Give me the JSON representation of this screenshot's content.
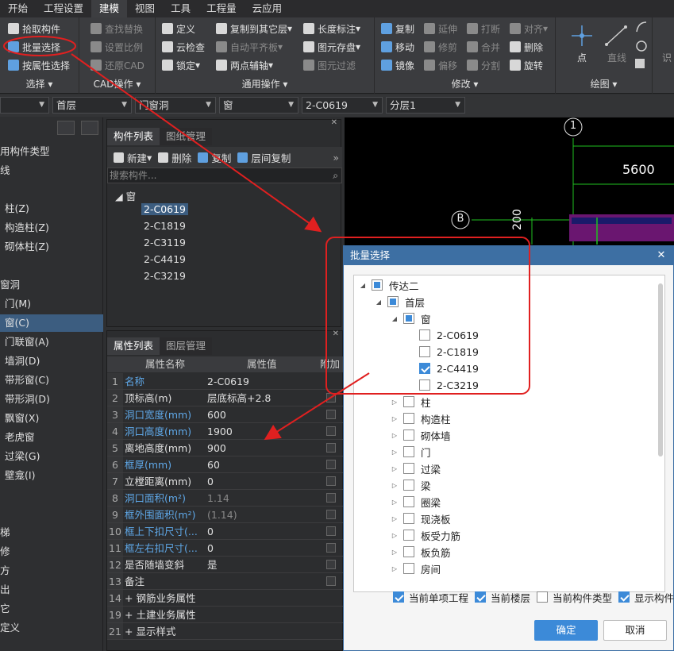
{
  "menu": {
    "tabs": [
      "开始",
      "工程设置",
      "建模",
      "视图",
      "工具",
      "工程量",
      "云应用"
    ],
    "active_index": 2
  },
  "ribbon": {
    "select_group": {
      "title": "选择",
      "items": [
        "拾取构件",
        "批量选择",
        "按属性选择"
      ]
    },
    "cad_group": {
      "title": "CAD操作",
      "items": [
        "查找替换",
        "设置比例",
        "还原CAD"
      ]
    },
    "common_group": {
      "title": "通用操作",
      "items": [
        "定义",
        "云检查",
        "锁定",
        "复制到其它层",
        "自动平齐板",
        "两点辅轴",
        "长度标注",
        "图元存盘",
        "图元过滤"
      ]
    },
    "modify_group": {
      "title": "修改",
      "items": [
        "复制",
        "移动",
        "镜像",
        "延伸",
        "修剪",
        "偏移",
        "打断",
        "合并",
        "分割",
        "对齐",
        "删除",
        "旋转"
      ]
    },
    "draw_group": {
      "title": "绘图",
      "items": [
        "点",
        "直线"
      ]
    },
    "extra": "识"
  },
  "combos": {
    "floor": "首层",
    "category": "门窗洞",
    "type": "窗",
    "component": "2-C0619",
    "layer": "分层1"
  },
  "leftnav": {
    "items": [
      "用构件类型",
      "线",
      "柱(Z)",
      "构造柱(Z)",
      "砌体柱(Z)",
      "窗洞",
      "门(M)",
      "窗(C)",
      "门联窗(A)",
      "墙洞(D)",
      "带形窗(C)",
      "带形洞(D)",
      "飘窗(X)",
      "老虎窗",
      "过梁(G)",
      "壁龛(I)",
      "梯",
      "修",
      "方",
      "出",
      "它",
      "定义"
    ],
    "selected_index": 7
  },
  "complist": {
    "tabs": [
      "构件列表",
      "图纸管理"
    ],
    "toolbar": [
      "新建",
      "删除",
      "复制",
      "层间复制"
    ],
    "search_placeholder": "搜索构件...",
    "root": "窗",
    "items": [
      "2-C0619",
      "2-C1819",
      "2-C3119",
      "2-C4419",
      "2-C3219"
    ],
    "selected_index": 0
  },
  "props": {
    "tabs": [
      "属性列表",
      "图层管理"
    ],
    "headers": [
      "属性名称",
      "属性值",
      "附加"
    ],
    "rows": [
      {
        "num": "1",
        "name": "名称",
        "value": "2-C0619",
        "blue": true,
        "check": false
      },
      {
        "num": "2",
        "name": "顶标高(m)",
        "value": "层底标高+2.8",
        "blue": false,
        "check": true
      },
      {
        "num": "3",
        "name": "洞口宽度(mm)",
        "value": "600",
        "blue": true,
        "check": true
      },
      {
        "num": "4",
        "name": "洞口高度(mm)",
        "value": "1900",
        "blue": true,
        "check": true
      },
      {
        "num": "5",
        "name": "离地高度(mm)",
        "value": "900",
        "blue": false,
        "check": true
      },
      {
        "num": "6",
        "name": "框厚(mm)",
        "value": "60",
        "blue": true,
        "check": true
      },
      {
        "num": "7",
        "name": "立樘距离(mm)",
        "value": "0",
        "blue": false,
        "check": true
      },
      {
        "num": "8",
        "name": "洞口面积(m²)",
        "value": "1.14",
        "blue": true,
        "check": true,
        "dim": true
      },
      {
        "num": "9",
        "name": "框外围面积(m²)",
        "value": "(1.14)",
        "blue": true,
        "check": true,
        "dim": true
      },
      {
        "num": "10",
        "name": "框上下扣尺寸(...",
        "value": "0",
        "blue": true,
        "check": true
      },
      {
        "num": "11",
        "name": "框左右扣尺寸(...",
        "value": "0",
        "blue": true,
        "check": true
      },
      {
        "num": "12",
        "name": "是否随墙变斜",
        "value": "是",
        "blue": false,
        "check": true
      },
      {
        "num": "13",
        "name": "备注",
        "value": "",
        "blue": false,
        "check": true
      },
      {
        "num": "14",
        "name": "+ 钢筋业务属性",
        "value": "",
        "blue": false,
        "check": false
      },
      {
        "num": "19",
        "name": "+ 土建业务属性",
        "value": "",
        "blue": false,
        "check": false
      },
      {
        "num": "21",
        "name": "+ 显示样式",
        "value": "",
        "blue": false,
        "check": false
      }
    ]
  },
  "canvas": {
    "axis_1": "1",
    "axis_b": "B",
    "dimension": "5600",
    "vertical_text": "200"
  },
  "dialog": {
    "title": "批量选择",
    "tree": [
      {
        "label": "传达二",
        "level": 0,
        "expand": "down",
        "state": "partial"
      },
      {
        "label": "首层",
        "level": 1,
        "expand": "down",
        "state": "partial"
      },
      {
        "label": "窗",
        "level": 2,
        "expand": "down",
        "state": "partial"
      },
      {
        "label": "2-C0619",
        "level": 3,
        "expand": "none",
        "state": "unchecked"
      },
      {
        "label": "2-C1819",
        "level": 3,
        "expand": "none",
        "state": "unchecked"
      },
      {
        "label": "2-C4419",
        "level": 3,
        "expand": "none",
        "state": "checked"
      },
      {
        "label": "2-C3219",
        "level": 3,
        "expand": "none",
        "state": "unchecked"
      },
      {
        "label": "柱",
        "level": 2,
        "expand": "right",
        "state": "unchecked"
      },
      {
        "label": "构造柱",
        "level": 2,
        "expand": "right",
        "state": "unchecked"
      },
      {
        "label": "砌体墙",
        "level": 2,
        "expand": "right",
        "state": "unchecked"
      },
      {
        "label": "门",
        "level": 2,
        "expand": "right",
        "state": "unchecked"
      },
      {
        "label": "过梁",
        "level": 2,
        "expand": "right",
        "state": "unchecked"
      },
      {
        "label": "梁",
        "level": 2,
        "expand": "right",
        "state": "unchecked"
      },
      {
        "label": "圈梁",
        "level": 2,
        "expand": "right",
        "state": "unchecked"
      },
      {
        "label": "现浇板",
        "level": 2,
        "expand": "right",
        "state": "unchecked"
      },
      {
        "label": "板受力筋",
        "level": 2,
        "expand": "right",
        "state": "unchecked"
      },
      {
        "label": "板负筋",
        "level": 2,
        "expand": "right",
        "state": "unchecked"
      },
      {
        "label": "房间",
        "level": 2,
        "expand": "right",
        "state": "unchecked"
      }
    ],
    "options": [
      {
        "label": "当前单项工程",
        "checked": true
      },
      {
        "label": "当前楼层",
        "checked": true
      },
      {
        "label": "当前构件类型",
        "checked": false
      },
      {
        "label": "显示构件",
        "checked": true
      }
    ],
    "ok": "确定",
    "cancel": "取消"
  },
  "colors": {
    "accent": "#3c8ad8",
    "annotation_red": "#e02020",
    "title_bar": "#3d6fa3",
    "cad_green": "#20c020",
    "cad_magenta": "#8a1a8a"
  }
}
